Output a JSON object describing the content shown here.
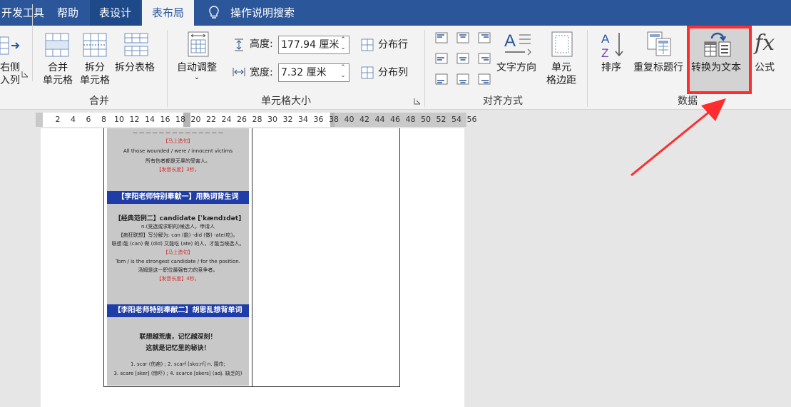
{
  "tabs": {
    "developer": "开发工具",
    "help": "帮助",
    "table_design": "表设计",
    "table_layout": "表布局",
    "tell_me": "操作说明搜索"
  },
  "ribbon": {
    "insert_right_line1": "右侧",
    "insert_right_line2": "入列",
    "merge_cells_line1": "合并",
    "merge_cells_line2": "单元格",
    "split_cells_line1": "拆分",
    "split_cells_line2": "单元格",
    "split_table": "拆分表格",
    "merge_group": "合并",
    "autofit": "自动调整",
    "height_label": "高度:",
    "height_value": "177.94 厘米",
    "width_label": "宽度:",
    "width_value": "7.32 厘米",
    "distribute_rows": "分布行",
    "distribute_cols": "分布列",
    "cell_size_group": "单元格大小",
    "text_direction": "文字方向",
    "cell_margins_line1": "单元",
    "cell_margins_line2": "格边距",
    "alignment_group": "对齐方式",
    "sort": "排序",
    "repeat_header": "重复标题行",
    "convert_to_text": "转换为文本",
    "formula": "公式",
    "data_group": "数据"
  },
  "ruler": [
    "2",
    "4",
    "6",
    "8",
    "10",
    "12",
    "14",
    "16",
    "18",
    "20",
    "22",
    "24",
    "26",
    "28",
    "30",
    "32",
    "34",
    "36",
    "38",
    "40",
    "42",
    "44",
    "46",
    "48",
    "50",
    "52",
    "54",
    "56"
  ],
  "document_image": {
    "line1": "All those wounded / were / innocent victims",
    "line2": "所有伤者都是无辜的受害人。",
    "tag_sentence": "【马上造句】",
    "tag_duration1": "【发音长度】3秒。",
    "banner1": "【李阳老师特别奉献一】用熟词背生词",
    "example2": "【经典范例二】candidate [ˈkændɪdət]",
    "definition": "n.(竞选或求职的)候选人，申请人",
    "split": "【疯狂联想】写分解为: can (能) -did (做) -ate(吃)。",
    "association": "联想:能 (can) 做 (did) 又能吃 (ate) 的人，才能当候选人。",
    "tag_sentence2": "【马上造句】",
    "sentence2": "Tom / is the strongest candidate / for the position.",
    "sentence2_cn": "汤姆是这一职位最强有力的竞争者。",
    "tag_duration2": "【发音长度】4秒。",
    "banner2": "【李阳老师特别奉献二】胡思乱想背单词",
    "slogan1": "联想越荒唐，记忆越深刻！",
    "slogan2": "这就是记忆里的秘诀！",
    "words1": "1. scar (伤疤) ; 2. scarf [skɑːrf] n. 围巾;",
    "words2": "3. scare [sker] (惊吓) ; 4. scarce [skers] (adj. 缺乏的)"
  },
  "colors": {
    "title_bar": "#2b579a",
    "highlight": "#ff2d2d"
  }
}
